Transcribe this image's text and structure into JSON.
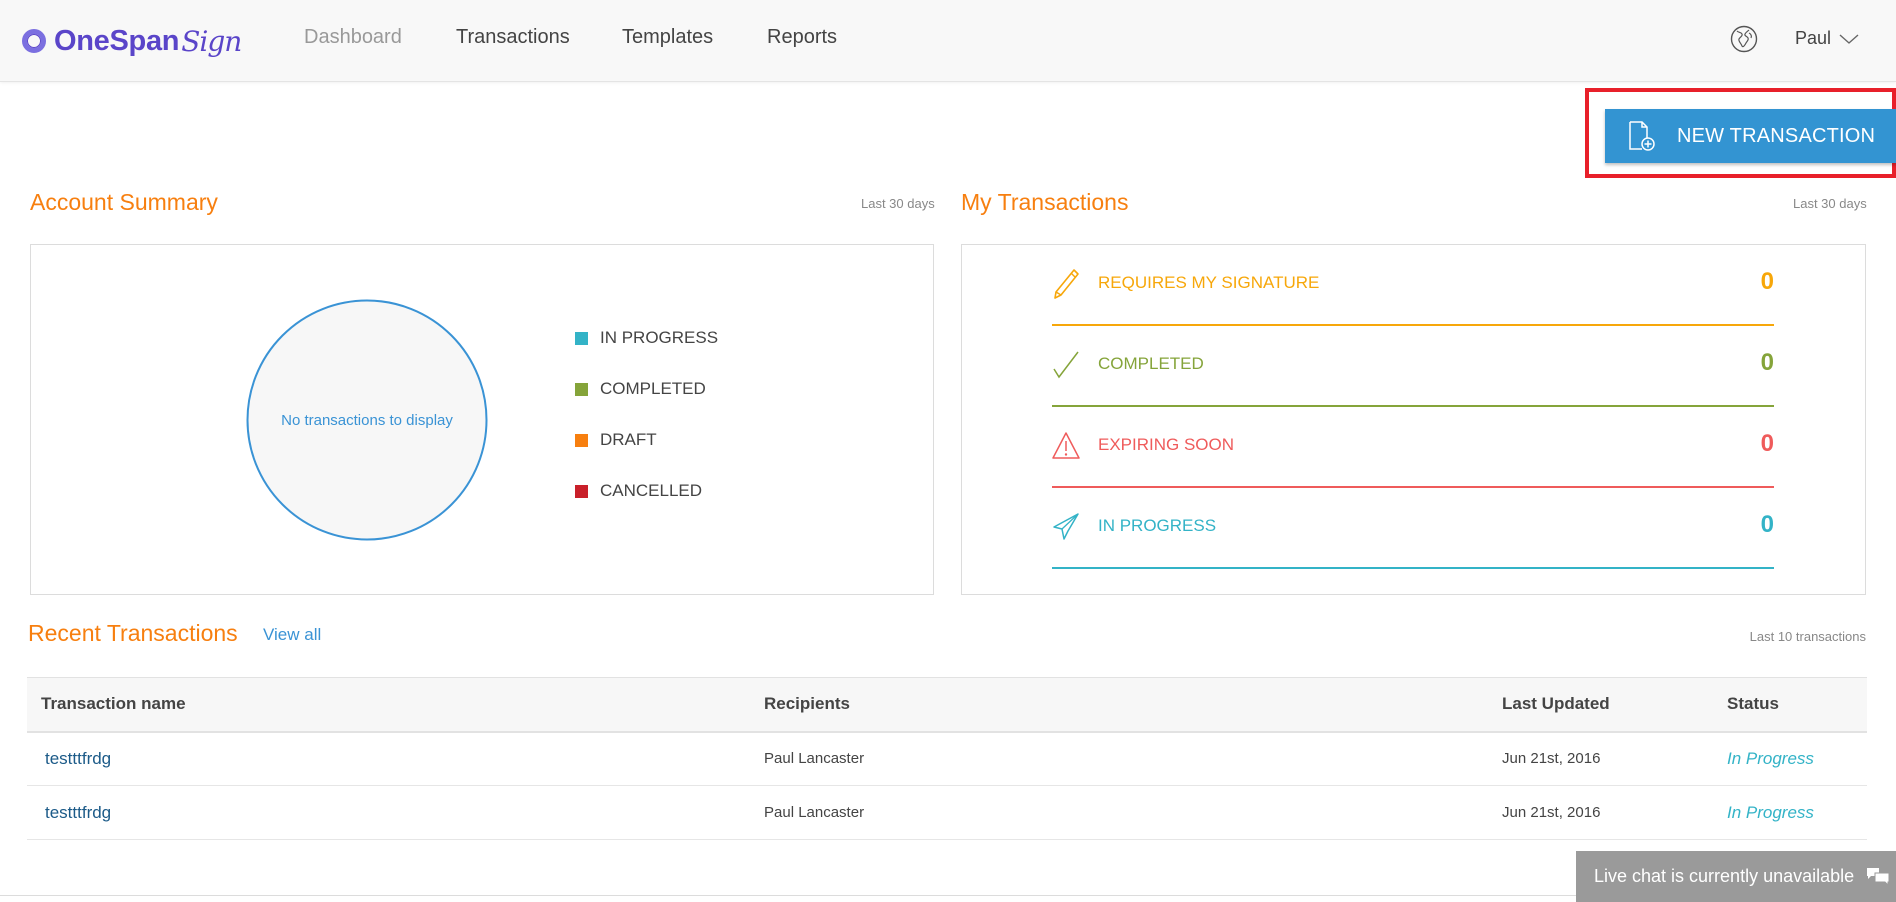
{
  "header": {
    "logo_brand": "OneSpan",
    "logo_sign": "Sign",
    "nav": [
      {
        "label": "Dashboard",
        "active": true
      },
      {
        "label": "Transactions",
        "active": false
      },
      {
        "label": "Templates",
        "active": false
      },
      {
        "label": "Reports",
        "active": false
      }
    ],
    "user_name": "Paul",
    "icons": {
      "language": "globe-icon",
      "user_menu": "chevron-down-icon"
    }
  },
  "actions": {
    "new_transaction_label": "NEW TRANSACTION",
    "new_transaction_icon": "document-plus-icon",
    "highlight_color": "#e8202a",
    "button_color": "#3394d2"
  },
  "account_summary": {
    "title": "Account Summary",
    "period": "Last 30 days",
    "empty_message": "No transactions to display",
    "legend": [
      {
        "label": "IN PROGRESS",
        "color": "#33b3c7"
      },
      {
        "label": "COMPLETED",
        "color": "#85a43a"
      },
      {
        "label": "DRAFT",
        "color": "#f77f0f"
      },
      {
        "label": "CANCELLED",
        "color": "#c9202a"
      }
    ]
  },
  "my_transactions": {
    "title": "My Transactions",
    "period": "Last 30 days",
    "rows": [
      {
        "label": "REQUIRES MY SIGNATURE",
        "count": "0",
        "color": "#f7a70a",
        "icon": "pencil-icon"
      },
      {
        "label": "COMPLETED",
        "count": "0",
        "color": "#85a43a",
        "icon": "checkmark-icon"
      },
      {
        "label": "EXPIRING SOON",
        "count": "0",
        "color": "#ef5b5b",
        "icon": "warning-icon"
      },
      {
        "label": "IN PROGRESS",
        "count": "0",
        "color": "#33b3c7",
        "icon": "paper-plane-icon"
      }
    ]
  },
  "recent_transactions": {
    "title": "Recent Transactions",
    "view_all": "View all",
    "subtitle": "Last 10 transactions",
    "columns": [
      "Transaction name",
      "Recipients",
      "Last Updated",
      "Status"
    ],
    "rows": [
      {
        "name": "testttfrdg",
        "recipients": "Paul Lancaster",
        "updated": "Jun 21st, 2016",
        "status": "In Progress"
      },
      {
        "name": "testttfrdg",
        "recipients": "Paul Lancaster",
        "updated": "Jun 21st, 2016",
        "status": "In Progress"
      }
    ]
  },
  "livechat": {
    "label": "Live chat is currently unavailable",
    "icon": "chat-bubbles-icon"
  },
  "colors": {
    "section_title": "#f77f0f",
    "link": "#3a93d5",
    "pie_outline": "#3a93d5"
  }
}
